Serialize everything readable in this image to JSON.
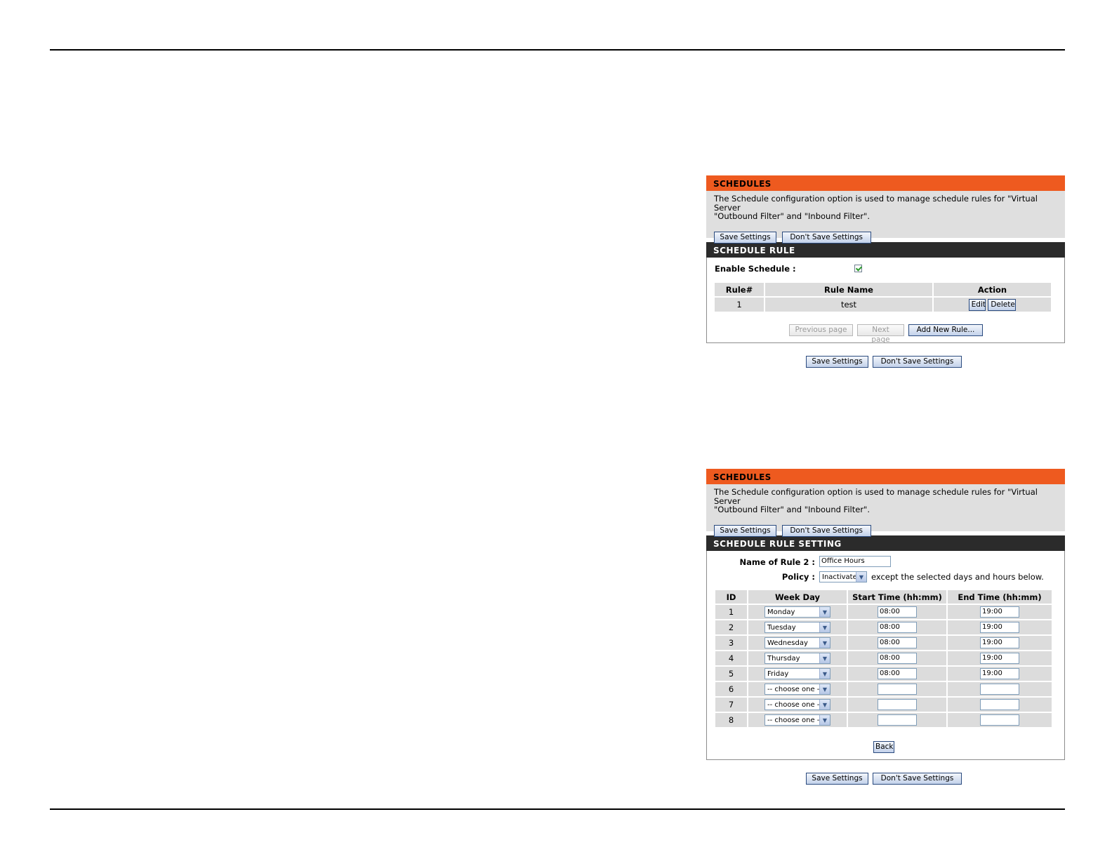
{
  "panel1": {
    "header": "SCHEDULES",
    "intro_line1": "The Schedule configuration option is used to manage schedule rules for \"Virtual Server",
    "intro_line2": "\"Outbound Filter\" and \"Inbound Filter\".",
    "save_label": "Save Settings",
    "dont_save_label": "Don't Save Settings",
    "rule_header": "SCHEDULE RULE",
    "enable_label": "Enable Schedule :",
    "enable_checked": true,
    "table": {
      "columns": [
        "Rule#",
        "Rule Name",
        "Action"
      ],
      "rows": [
        {
          "rule": "1",
          "name": "test"
        }
      ]
    },
    "edit_label": "Edit",
    "delete_label": "Delete",
    "prev_label": "Previous page",
    "next_label": "Next page",
    "add_label": "Add New Rule...",
    "bottom_save_label": "Save Settings",
    "bottom_dont_save_label": "Don't Save Settings"
  },
  "panel2": {
    "header": "SCHEDULES",
    "intro_line1": "The Schedule configuration option is used to manage schedule rules for \"Virtual Server",
    "intro_line2": "\"Outbound Filter\" and \"Inbound Filter\".",
    "save_label": "Save Settings",
    "dont_save_label": "Don't Save Settings",
    "setting_header": "SCHEDULE RULE SETTING",
    "name_label": "Name of Rule 2 :",
    "name_value": "Office Hours",
    "policy_label": "Policy :",
    "policy_value": "Inactivate",
    "policy_suffix": "except the selected days and hours below.",
    "table": {
      "columns": [
        "ID",
        "Week Day",
        "Start Time (hh:mm)",
        "End Time (hh:mm)"
      ],
      "rows": [
        {
          "id": "1",
          "day": "Monday",
          "start": "08:00",
          "end": "19:00"
        },
        {
          "id": "2",
          "day": "Tuesday",
          "start": "08:00",
          "end": "19:00"
        },
        {
          "id": "3",
          "day": "Wednesday",
          "start": "08:00",
          "end": "19:00"
        },
        {
          "id": "4",
          "day": "Thursday",
          "start": "08:00",
          "end": "19:00"
        },
        {
          "id": "5",
          "day": "Friday",
          "start": "08:00",
          "end": "19:00"
        },
        {
          "id": "6",
          "day": "-- choose one --",
          "start": "",
          "end": ""
        },
        {
          "id": "7",
          "day": "-- choose one --",
          "start": "",
          "end": ""
        },
        {
          "id": "8",
          "day": "-- choose one --",
          "start": "",
          "end": ""
        }
      ]
    },
    "back_label": "Back",
    "bottom_save_label": "Save Settings",
    "bottom_dont_save_label": "Don't Save Settings"
  },
  "colors": {
    "orange_header": "#ee5a1f",
    "dark_header": "#2b2b2b",
    "intro_bg": "#dfdfdf",
    "table_cell": "#dcdcdc"
  },
  "icons": {
    "select_arrow": "chevron-down-icon",
    "checkbox": "checkmark-icon"
  }
}
